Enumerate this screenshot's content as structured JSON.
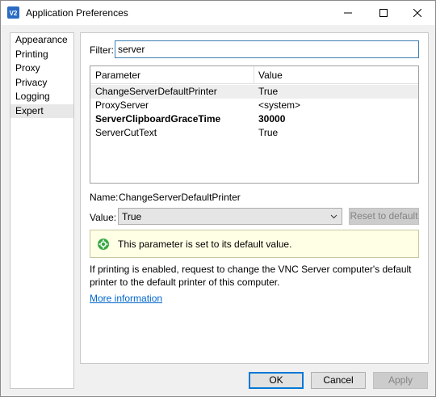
{
  "window": {
    "title": "Application Preferences",
    "icon_text": "V2"
  },
  "sidebar": {
    "items": [
      {
        "label": "Appearance"
      },
      {
        "label": "Printing"
      },
      {
        "label": "Proxy"
      },
      {
        "label": "Privacy"
      },
      {
        "label": "Logging"
      },
      {
        "label": "Expert",
        "selected": true
      }
    ]
  },
  "filter": {
    "label": "Filter:",
    "value": "server"
  },
  "table": {
    "columns": [
      "Parameter",
      "Value"
    ],
    "rows": [
      {
        "param": "ChangeServerDefaultPrinter",
        "value": "True",
        "selected": true,
        "bold": false
      },
      {
        "param": "ProxyServer",
        "value": "<system>",
        "selected": false,
        "bold": false
      },
      {
        "param": "ServerClipboardGraceTime",
        "value": "30000",
        "selected": false,
        "bold": true
      },
      {
        "param": "ServerCutText",
        "value": "True",
        "selected": false,
        "bold": false
      }
    ]
  },
  "detail": {
    "name_label": "Name:",
    "name_value": "ChangeServerDefaultPrinter",
    "value_label": "Value:",
    "value_selected": "True",
    "reset_label": "Reset to default",
    "info_text": "This parameter is set to its default value.",
    "description": "If printing is enabled, request to change the VNC Server computer's default printer to the default printer of this computer.",
    "more_link": "More information"
  },
  "buttons": {
    "ok": "OK",
    "cancel": "Cancel",
    "apply": "Apply"
  },
  "colors": {
    "accent": "#0078d7",
    "link": "#0066cc",
    "info_bg": "#ffffe6",
    "check_green": "#3aa845"
  }
}
